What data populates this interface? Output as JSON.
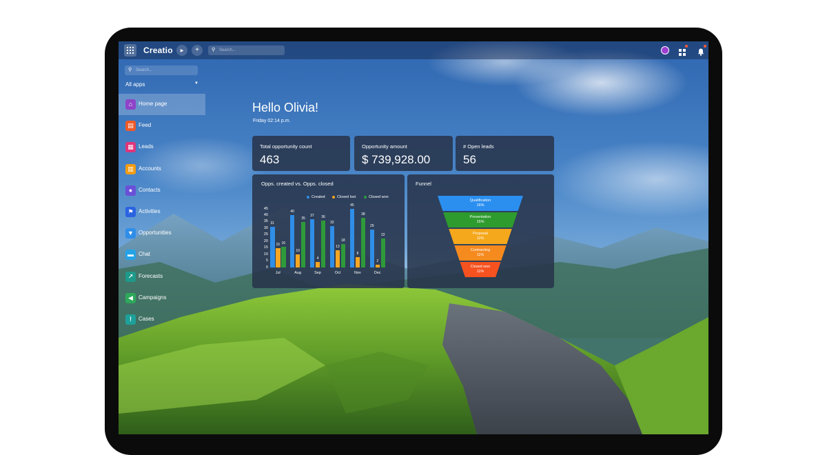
{
  "app": {
    "logo": "Creatio",
    "search_placeholder": "Search...",
    "run_icon": "▶",
    "add_icon": "+"
  },
  "sidebar": {
    "search_placeholder": "Search...",
    "app_filter": "All apps",
    "items": [
      {
        "label": "Home page",
        "icon": "home-icon",
        "color": "#8e44c8",
        "active": true
      },
      {
        "label": "Feed",
        "icon": "feed-icon",
        "color": "#f05a28"
      },
      {
        "label": "Leads",
        "icon": "leads-icon",
        "color": "#e0357a"
      },
      {
        "label": "Accounts",
        "icon": "accounts-icon",
        "color": "#f39c12"
      },
      {
        "label": "Contacts",
        "icon": "contacts-icon",
        "color": "#6a4fd8"
      },
      {
        "label": "Activities",
        "icon": "activities-icon",
        "color": "#2a63e0"
      },
      {
        "label": "Opportunities",
        "icon": "opportunities-icon",
        "color": "#2f8ee8"
      },
      {
        "label": "Chat",
        "icon": "chat-icon",
        "color": "#25a3e8"
      },
      {
        "label": "Forecasts",
        "icon": "forecasts-icon",
        "color": "#1e9a8a"
      },
      {
        "label": "Campaigns",
        "icon": "campaigns-icon",
        "color": "#2ea85a"
      },
      {
        "label": "Cases",
        "icon": "cases-icon",
        "color": "#1ea09a"
      }
    ]
  },
  "greeting": {
    "title": "Hello Olivia!",
    "subtitle": "Friday 02:14 p.m."
  },
  "kpis": [
    {
      "label": "Total opportunity count",
      "value": "463"
    },
    {
      "label": "Opportunity amount",
      "value": "$ 739,928.00"
    },
    {
      "label": "# Open leads",
      "value": "56"
    }
  ],
  "chart_data": [
    {
      "type": "bar",
      "title": "Opps. created vs. Opps. closed",
      "categories": [
        "Jul",
        "Aug",
        "Sep",
        "Oct",
        "Nov",
        "Dec"
      ],
      "series": [
        {
          "name": "Created",
          "color": "#2f8ee8",
          "values": [
            31,
            40,
            37,
            32,
            45,
            29
          ]
        },
        {
          "name": "Closed lost",
          "color": "#f5a623",
          "values": [
            15,
            10,
            4,
            13,
            8,
            2
          ]
        },
        {
          "name": "Closed won",
          "color": "#2e9a3a",
          "values": [
            16,
            35,
            36,
            18,
            38,
            22
          ]
        }
      ],
      "yticks": [
        0,
        5,
        10,
        15,
        20,
        25,
        30,
        35,
        40,
        45
      ],
      "ylim": [
        0,
        45
      ],
      "legend": "top-right"
    },
    {
      "type": "funnel",
      "title": "Funnel",
      "stages": [
        {
          "name": "Qualification",
          "value": "16%",
          "color": "#2b8ff0"
        },
        {
          "name": "Presentation",
          "value": "15%",
          "color": "#2e9b2e"
        },
        {
          "name": "Proposal",
          "value": "11%",
          "color": "#f5a81c"
        },
        {
          "name": "Contracting",
          "value": "11%",
          "color": "#f58a1f"
        },
        {
          "name": "Closed won",
          "value": "11%",
          "color": "#f5521f"
        }
      ]
    }
  ]
}
